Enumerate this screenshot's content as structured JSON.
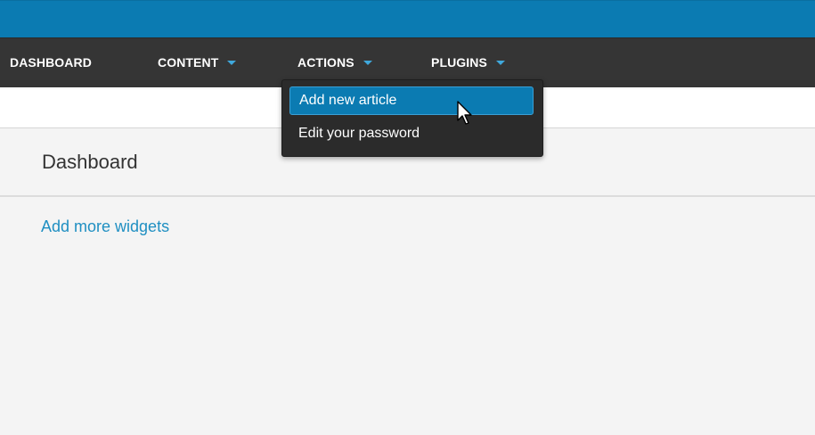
{
  "nav": {
    "items": [
      {
        "label": "DASHBOARD",
        "has_caret": false
      },
      {
        "label": "CONTENT",
        "has_caret": true
      },
      {
        "label": "ACTIONS",
        "has_caret": true
      },
      {
        "label": "PLUGINS",
        "has_caret": true
      }
    ]
  },
  "dropdown": {
    "items": [
      {
        "label": "Add new article",
        "active": true
      },
      {
        "label": "Edit your password",
        "active": false
      }
    ]
  },
  "page": {
    "title": "Dashboard",
    "widgets_link": "Add more widgets"
  },
  "colors": {
    "topbar": "#0b7bb2",
    "navbar": "#353535",
    "accent": "#3fa8dc",
    "link": "#1f8fc2",
    "background": "#f4f4f4"
  },
  "icons": {
    "caret": "caret-down-icon",
    "cursor": "mouse-pointer-icon"
  }
}
